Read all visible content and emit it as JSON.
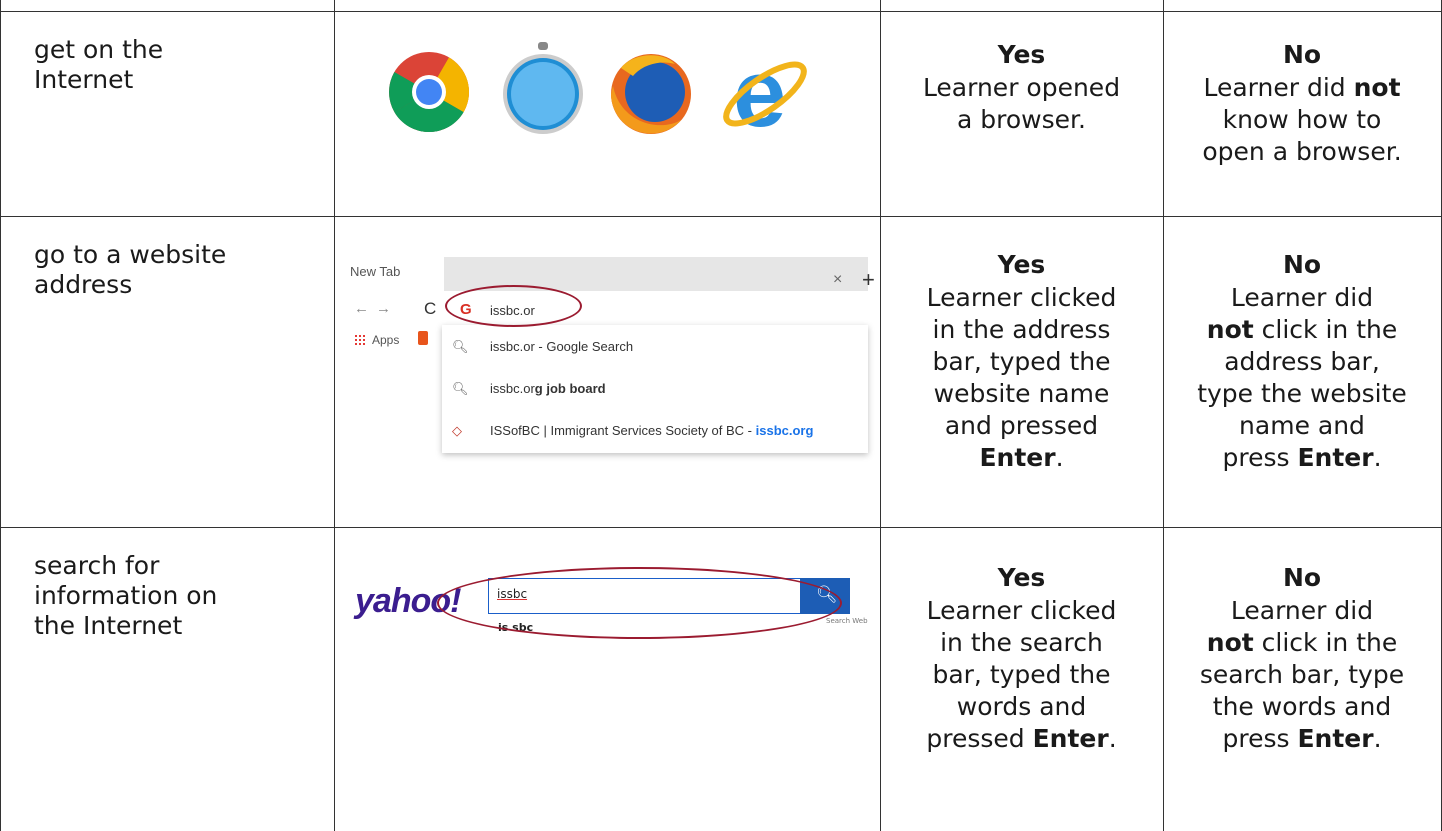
{
  "rows": [
    {
      "skill": [
        "get on the",
        "Internet"
      ],
      "yes": {
        "head": "Yes",
        "text_lines": [
          "Learner opened",
          "a browser."
        ]
      },
      "no": {
        "head": "No",
        "line1_pre": "Learner did ",
        "line1_bold": "not",
        "text_lines": [
          "know how to",
          "open a browser."
        ]
      }
    },
    {
      "skill": [
        "go to a website",
        "address"
      ],
      "yes": {
        "head": "Yes",
        "text_lines": [
          "Learner clicked",
          "in the address",
          "bar, typed the",
          "website name",
          "and pressed"
        ],
        "last_bold": "Enter",
        "last_tail": "."
      },
      "no": {
        "head": "No",
        "text_lines": [
          "Learner did"
        ],
        "bold_start": "not",
        "after_bold": " click in the",
        "more_lines": [
          "address bar,",
          "type the website",
          "name and"
        ],
        "last_pre": "press ",
        "last_bold": "Enter",
        "last_tail": "."
      }
    },
    {
      "skill": [
        "search for",
        "information on",
        "the Internet"
      ],
      "yes": {
        "head": "Yes",
        "text_lines": [
          "Learner clicked",
          "in the search",
          "bar, typed the",
          "words and"
        ],
        "last_pre": "pressed ",
        "last_bold": "Enter",
        "last_tail": "."
      },
      "no": {
        "head": "No",
        "text_lines": [
          "Learner did"
        ],
        "bold_start": "not",
        "after_bold": " click in the",
        "more_lines": [
          "search bar, type",
          "the words and"
        ],
        "last_pre": "press ",
        "last_bold": "Enter",
        "last_tail": "."
      }
    }
  ],
  "browser_icons": [
    "chrome-icon",
    "safari-icon",
    "firefox-icon",
    "internet-explorer-icon"
  ],
  "chrome_mock": {
    "tab_label": "New Tab",
    "tab_close": "×",
    "new_tab": "+",
    "omnibox_text": "issbc.or",
    "apps_label": "Apps",
    "suggestions": [
      {
        "icon": "search-icon",
        "text": "issbc.or - Google Search"
      },
      {
        "icon": "search-icon",
        "text_plain": "issbc.or",
        "text_bold": "g job board"
      },
      {
        "icon": "site-icon",
        "text_plain": "ISSofBC | Immigrant Services Society of BC - ",
        "text_link": "issbc.org"
      }
    ]
  },
  "yahoo_mock": {
    "logo": "yahoo!",
    "query": "issbc",
    "suggestion": "is sbc",
    "search_web": "Search Web"
  },
  "colors": {
    "highlight_oval": "#9b1b30",
    "yahoo_purple": "#3b1d8f",
    "yahoo_button": "#1d5db5",
    "link_blue": "#1a73e8"
  }
}
